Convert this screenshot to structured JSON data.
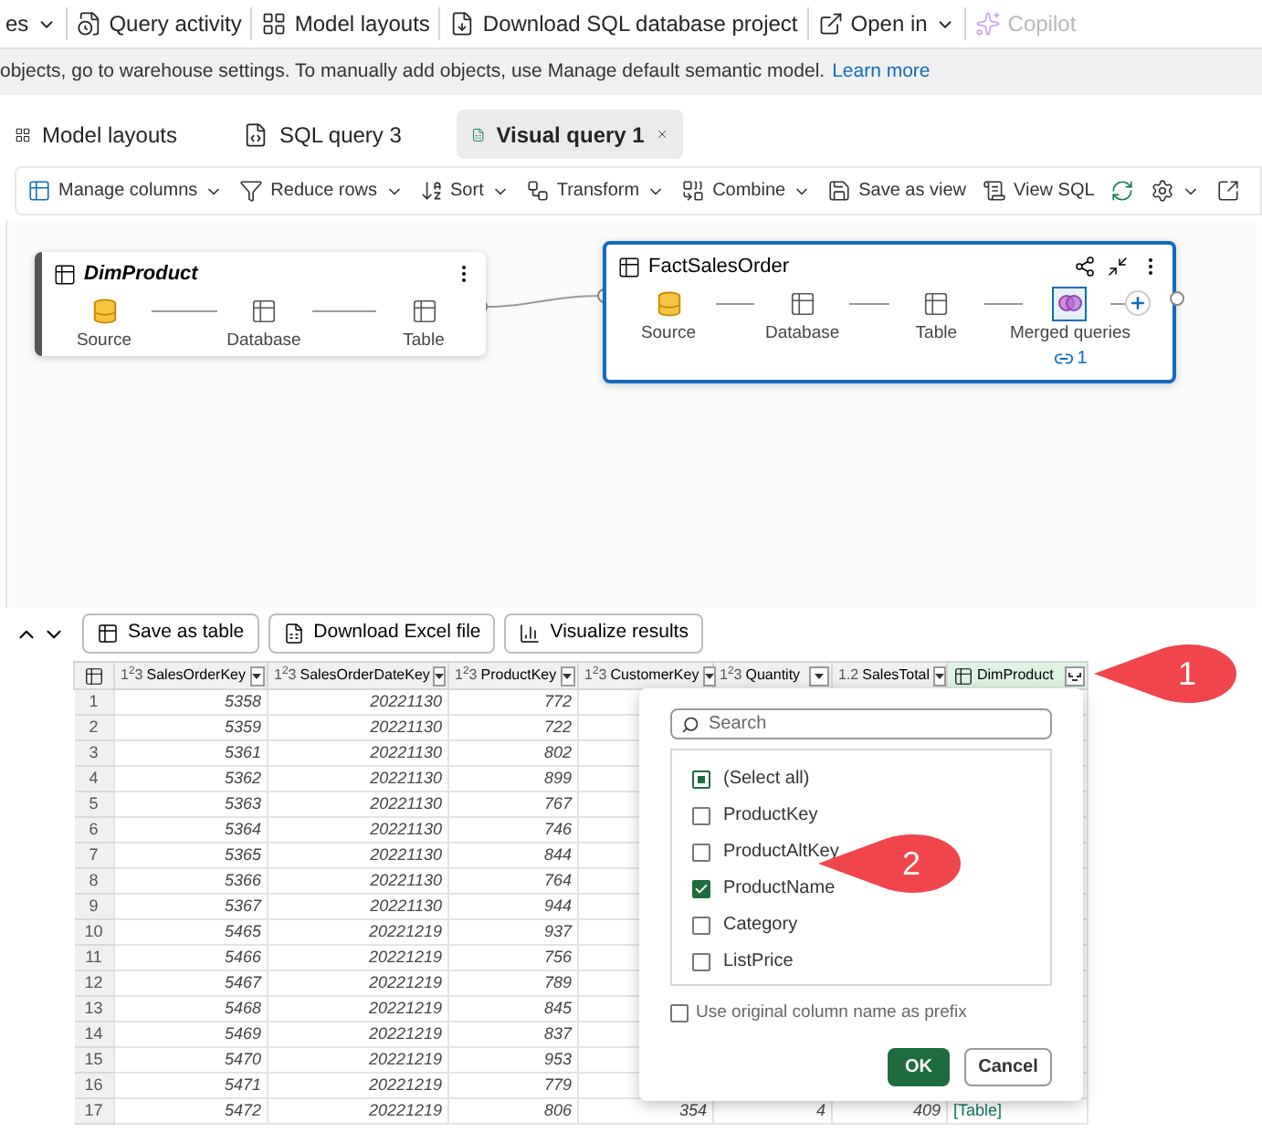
{
  "toolbar": [
    {
      "label": "es",
      "kind": "menu",
      "disabled": false
    },
    {
      "label": "Query activity",
      "kind": "activity",
      "disabled": false
    },
    {
      "label": "Model layouts",
      "kind": "layouts",
      "disabled": false
    },
    {
      "label": "Download SQL database project",
      "kind": "download",
      "disabled": false
    },
    {
      "label": "Open in",
      "kind": "open",
      "disabled": false
    },
    {
      "label": "Copilot",
      "kind": "copilot",
      "disabled": true
    }
  ],
  "info_bar": {
    "text": "objects, go to warehouse settings. To manually add objects, use Manage default semantic model.",
    "link": "Learn more"
  },
  "tabs": [
    {
      "label": "Model layouts",
      "kind": "layouts",
      "selected": false
    },
    {
      "label": "SQL query 3",
      "kind": "sql",
      "selected": false
    },
    {
      "label": "Visual query 1",
      "kind": "visual",
      "selected": true
    }
  ],
  "ribbon": [
    {
      "label": "Manage columns",
      "kind": "columns",
      "dropdown": true
    },
    {
      "label": "Reduce rows",
      "kind": "rows",
      "dropdown": true
    },
    {
      "label": "Sort",
      "kind": "sort",
      "dropdown": true
    },
    {
      "label": "Transform",
      "kind": "transform",
      "dropdown": true
    },
    {
      "label": "Combine",
      "kind": "combine",
      "dropdown": true
    },
    {
      "label": "Save as view",
      "kind": "view",
      "dropdown": false
    },
    {
      "label": "View SQL",
      "kind": "sql",
      "dropdown": false
    },
    {
      "kind": "refresh",
      "dropdown": false
    },
    {
      "kind": "settings",
      "dropdown": true
    },
    {
      "kind": "export",
      "dropdown": false
    }
  ],
  "diagram": {
    "nodes": [
      {
        "title": "DimProduct",
        "selected": false,
        "steps": [
          {
            "label": "Source",
            "kind": "source",
            "selected": false
          },
          {
            "label": "Database",
            "kind": "table",
            "selected": false
          },
          {
            "label": "Table",
            "kind": "table",
            "selected": false
          }
        ]
      },
      {
        "title": "FactSalesOrder",
        "selected": true,
        "steps": [
          {
            "label": "Source",
            "kind": "source",
            "selected": false
          },
          {
            "label": "Database",
            "kind": "table",
            "selected": false
          },
          {
            "label": "Table",
            "kind": "table",
            "selected": false
          },
          {
            "label": "Merged queries",
            "kind": "merge",
            "selected": true,
            "badge": "1"
          }
        ]
      }
    ]
  },
  "results": {
    "buttons": [
      {
        "label": "Save as table",
        "kind": "table"
      },
      {
        "label": "Download Excel file",
        "kind": "excel"
      },
      {
        "label": "Visualize results",
        "kind": "chart"
      }
    ],
    "columns": [
      {
        "type": "1$^{2}$3",
        "name": "SalesOrderKey",
        "kind": "number",
        "selected": false
      },
      {
        "type": "1$^{2}$3",
        "name": "SalesOrderDateKey",
        "kind": "number",
        "selected": false
      },
      {
        "type": "1$^{2}$3",
        "name": "ProductKey",
        "kind": "number",
        "selected": false
      },
      {
        "type": "1$^{2}$3",
        "name": "CustomerKey",
        "kind": "number",
        "selected": false
      },
      {
        "type": "1$^{2}$3",
        "name": "Quantity",
        "kind": "number",
        "selected": false
      },
      {
        "type": "1.2",
        "name": "SalesTotal",
        "kind": "number",
        "selected": false
      },
      {
        "name": "DimProduct",
        "kind": "table",
        "selected": true
      }
    ],
    "rows": [
      {
        "index": "1",
        "cells": [
          "5358",
          "20221130",
          "772"
        ]
      },
      {
        "index": "2",
        "cells": [
          "5359",
          "20221130",
          "722"
        ]
      },
      {
        "index": "3",
        "cells": [
          "5361",
          "20221130",
          "802"
        ]
      },
      {
        "index": "4",
        "cells": [
          "5362",
          "20221130",
          "899"
        ]
      },
      {
        "index": "5",
        "cells": [
          "5363",
          "20221130",
          "767"
        ]
      },
      {
        "index": "6",
        "cells": [
          "5364",
          "20221130",
          "746"
        ]
      },
      {
        "index": "7",
        "cells": [
          "5365",
          "20221130",
          "844"
        ]
      },
      {
        "index": "8",
        "cells": [
          "5366",
          "20221130",
          "764"
        ]
      },
      {
        "index": "9",
        "cells": [
          "5367",
          "20221130",
          "944"
        ]
      },
      {
        "index": "10",
        "cells": [
          "5465",
          "20221219",
          "937"
        ]
      },
      {
        "index": "11",
        "cells": [
          "5466",
          "20221219",
          "756"
        ]
      },
      {
        "index": "12",
        "cells": [
          "5467",
          "20221219",
          "789"
        ]
      },
      {
        "index": "13",
        "cells": [
          "5468",
          "20221219",
          "845"
        ]
      },
      {
        "index": "14",
        "cells": [
          "5469",
          "20221219",
          "837"
        ]
      },
      {
        "index": "15",
        "cells": [
          "5470",
          "20221219",
          "953"
        ]
      },
      {
        "index": "16",
        "cells": [
          "5471",
          "20221219",
          "779"
        ]
      },
      {
        "index": "17",
        "cells": [
          "5472",
          "20221219",
          "806",
          "354",
          "4",
          "409",
          "[Table]"
        ]
      }
    ]
  },
  "filter_popup": {
    "search": {
      "placeholder": "Search"
    },
    "options": [
      {
        "label": "(Select all)",
        "kind": "select_all",
        "checked": true
      },
      {
        "label": "ProductKey",
        "kind": "option",
        "checked": false
      },
      {
        "label": "ProductAltKey",
        "kind": "option",
        "checked": false
      },
      {
        "label": "ProductName",
        "kind": "option",
        "checked": true
      },
      {
        "label": "Category",
        "kind": "option",
        "checked": false
      },
      {
        "label": "ListPrice",
        "kind": "option",
        "checked": false
      }
    ],
    "prefix_option": {
      "label": "Use original column name as prefix",
      "checked": false
    },
    "buttons": [
      {
        "label": "OK",
        "primary": true
      },
      {
        "label": "Cancel",
        "primary": false
      }
    ]
  },
  "callouts": [
    {
      "number": "1"
    },
    {
      "number": "2"
    }
  ]
}
